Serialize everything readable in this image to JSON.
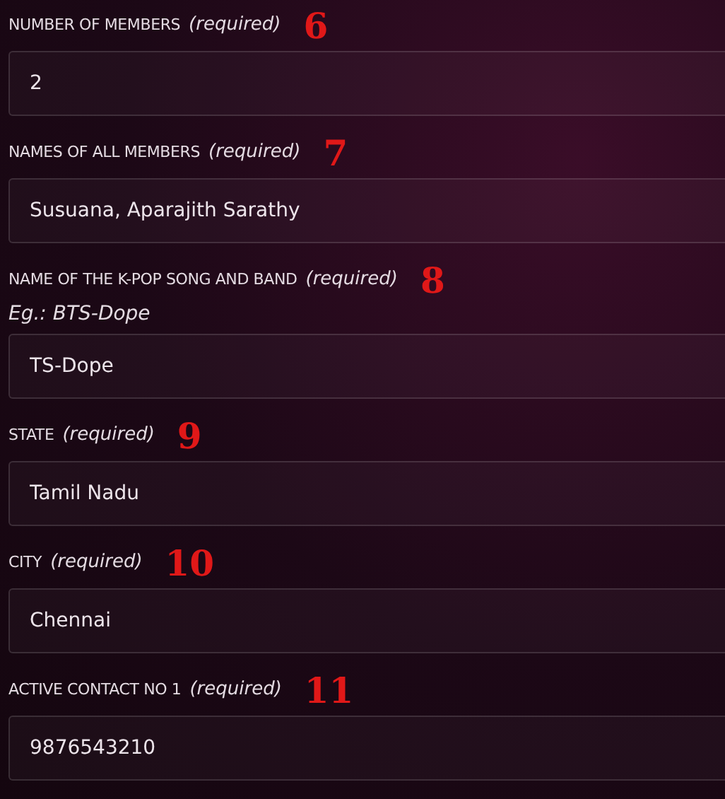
{
  "fields": [
    {
      "label": "NUMBER OF MEMBERS",
      "required_note": "(required)",
      "annotation": "6",
      "value": "2"
    },
    {
      "label": "NAMES OF ALL MEMBERS",
      "required_note": "(required)",
      "annotation": "7",
      "value": "Susuana, Aparajith Sarathy"
    },
    {
      "label": "NAME OF THE K-POP SONG AND BAND",
      "required_note": "(required)",
      "annotation": "8",
      "hint": "Eg.: BTS-Dope",
      "value": "TS-Dope"
    },
    {
      "label": "STATE",
      "required_note": "(required)",
      "annotation": "9",
      "value": "Tamil Nadu"
    },
    {
      "label": "CITY",
      "required_note": "(required)",
      "annotation": "10",
      "value": "Chennai"
    },
    {
      "label": "ACTIVE CONTACT NO 1",
      "required_note": "(required)",
      "annotation": "11",
      "value": "9876543210"
    }
  ]
}
